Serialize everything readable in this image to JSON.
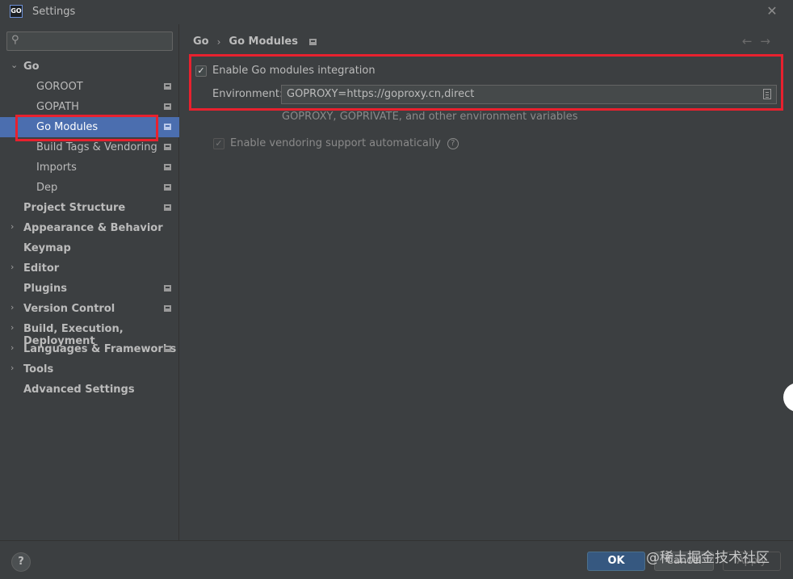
{
  "window": {
    "title": "Settings",
    "app_icon_text": "GO",
    "close_glyph": "✕"
  },
  "search": {
    "icon": "search-icon",
    "glyph": "⚲",
    "value": ""
  },
  "sidebar": {
    "items": [
      {
        "label": "Go",
        "expanded": true,
        "project": false
      },
      {
        "label": "GOROOT",
        "project": true
      },
      {
        "label": "GOPATH",
        "project": true
      },
      {
        "label": "Go Modules",
        "project": true,
        "selected": true
      },
      {
        "label": "Build Tags & Vendoring",
        "project": true
      },
      {
        "label": "Imports",
        "project": true
      },
      {
        "label": "Dep",
        "project": true
      },
      {
        "label": "Project Structure",
        "project": true
      },
      {
        "label": "Appearance & Behavior",
        "expandable": true
      },
      {
        "label": "Keymap"
      },
      {
        "label": "Editor",
        "expandable": true
      },
      {
        "label": "Plugins",
        "project": true
      },
      {
        "label": "Version Control",
        "expandable": true,
        "project": true
      },
      {
        "label": "Build, Execution, Deployment",
        "expandable": true
      },
      {
        "label": "Languages & Frameworks",
        "expandable": true,
        "project": true
      },
      {
        "label": "Tools",
        "expandable": true
      },
      {
        "label": "Advanced Settings"
      }
    ]
  },
  "breadcrumb": {
    "parent": "Go",
    "separator": "›",
    "current": "Go Modules"
  },
  "nav": {
    "back": "←",
    "forward": "→"
  },
  "modules": {
    "enable_label": "Enable Go modules integration",
    "enable_checked": true,
    "check_glyph": "✓",
    "env_label": "Environment:",
    "env_value": "GOPROXY=https://goproxy.cn,direct",
    "env_hint": "GOPROXY, GOPRIVATE, and other environment variables",
    "vendoring_label": "Enable vendoring support automatically",
    "vendoring_checked": true,
    "vendoring_enabled": false,
    "help_glyph": "?"
  },
  "footer": {
    "help_glyph": "?",
    "ok_label": "OK",
    "cancel_label": "Cancel",
    "apply_label": "Apply",
    "watermark": "@稀土掘金技术社区"
  },
  "colors": {
    "background": "#3c3f41",
    "selection": "#4b6eaf",
    "highlight": "#e8212e",
    "ok_button": "#365880"
  }
}
